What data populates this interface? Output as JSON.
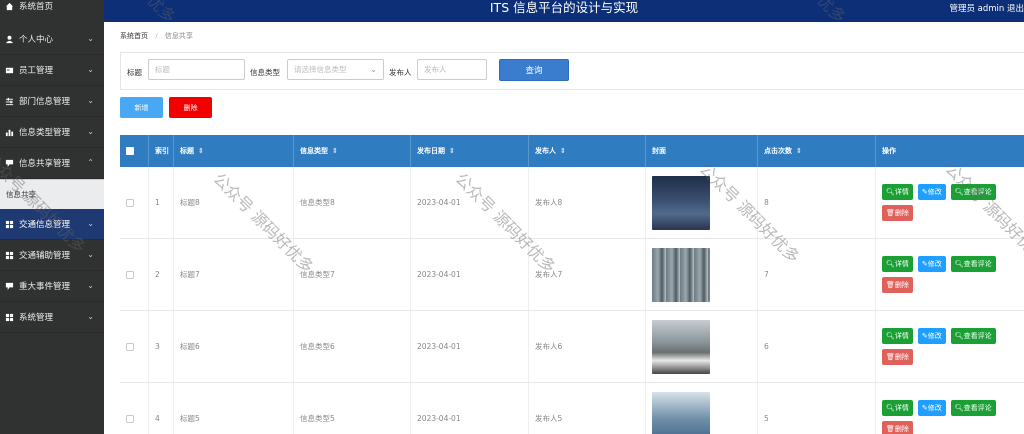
{
  "header": {
    "title": "ITS 信息平台的设计与实现",
    "user": "管理员 admin  退出"
  },
  "sidebar": {
    "top_label": "系统首页",
    "items": [
      {
        "label": "个人中心",
        "icon": "user-icon"
      },
      {
        "label": "员工管理",
        "icon": "card-icon"
      },
      {
        "label": "部门信息管理",
        "icon": "sliders-icon"
      },
      {
        "label": "信息类型管理",
        "icon": "chart-icon"
      },
      {
        "label": "信息共享管理",
        "icon": "comment-icon"
      }
    ],
    "sub_item": "信息共享",
    "items2": [
      {
        "label": "交通信息管理",
        "icon": "grid-icon"
      },
      {
        "label": "交通辅助管理",
        "icon": "grid-icon"
      },
      {
        "label": "重大事件管理",
        "icon": "comment-icon"
      },
      {
        "label": "系统管理",
        "icon": "grid-icon"
      }
    ]
  },
  "breadcrumb": {
    "home": "系统首页",
    "current": "信息共享"
  },
  "search": {
    "title_label": "标题",
    "title_placeholder": "标题",
    "type_label": "信息类型",
    "type_placeholder": "请选择信息类型",
    "publisher_label": "发布人",
    "publisher_placeholder": "发布人",
    "query_button": "查询"
  },
  "actions": {
    "new": "新增",
    "delete": "删除"
  },
  "table": {
    "headers": [
      "索引",
      "标题",
      "信息类型",
      "发布日期",
      "发布人",
      "封面",
      "点击次数",
      "操作"
    ],
    "rows": [
      {
        "index": "1",
        "title": "标题8",
        "type": "信息类型8",
        "date": "2023-04-01",
        "publisher": "发布人8",
        "clicks": "8"
      },
      {
        "index": "2",
        "title": "标题7",
        "type": "信息类型7",
        "date": "2023-04-01",
        "publisher": "发布人7",
        "clicks": "7"
      },
      {
        "index": "3",
        "title": "标题6",
        "type": "信息类型6",
        "date": "2023-04-01",
        "publisher": "发布人6",
        "clicks": "6"
      },
      {
        "index": "4",
        "title": "标题5",
        "type": "信息类型5",
        "date": "2023-04-01",
        "publisher": "发布人5",
        "clicks": "5"
      }
    ],
    "ops": {
      "detail": "详情",
      "edit": "修改",
      "comment": "查看评论",
      "delete": "删除"
    }
  },
  "watermark": "公众号 源码好优多",
  "colors": {
    "sidebar": "#303131",
    "header": "#0d2f77",
    "table_header": "#2f7cc0",
    "query": "#3a7dcf",
    "danger": "#f20000"
  }
}
